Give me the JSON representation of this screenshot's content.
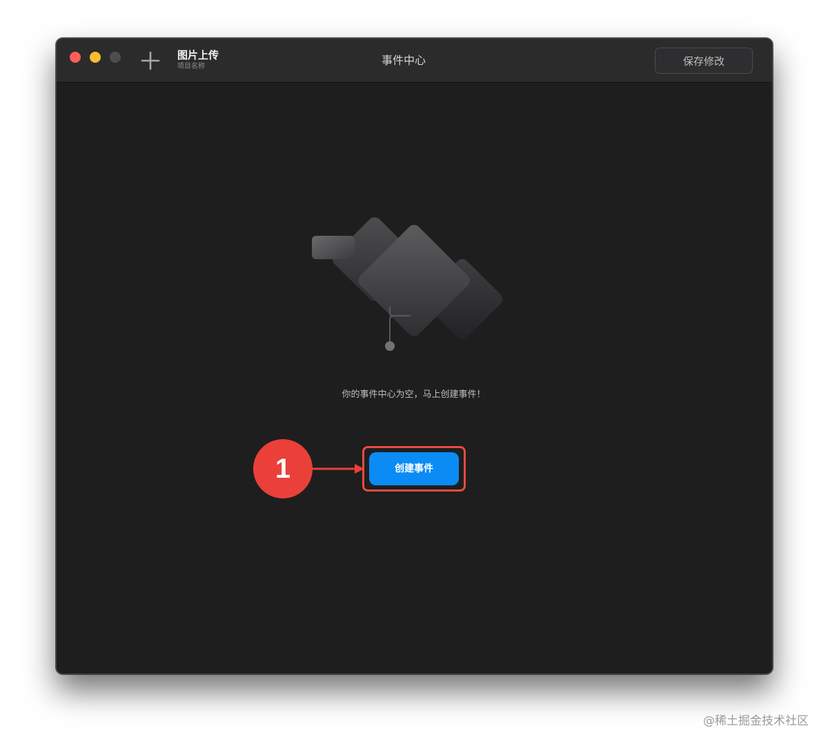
{
  "window": {
    "project_title": "图片上传",
    "project_subtitle": "项目名称",
    "title": "事件中心",
    "save_label": "保存修改"
  },
  "icons": {
    "add": "plus-icon"
  },
  "empty_state": {
    "message": "你的事件中心为空，马上创建事件！",
    "create_label": "创建事件"
  },
  "annotation": {
    "step_number": "1",
    "color": "#ea4039"
  },
  "colors": {
    "accent": "#0b8cf5",
    "background": "#1e1e1f",
    "titlebar": "#2b2b2c"
  },
  "watermark": "@稀土掘金技术社区"
}
